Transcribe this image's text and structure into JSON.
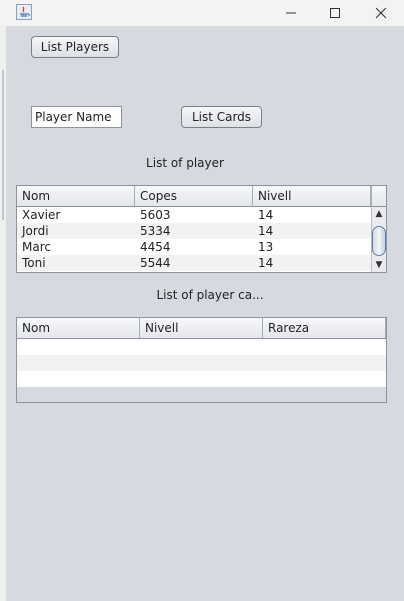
{
  "window": {
    "icon": "java-icon",
    "controls": {
      "minimize": "minimize-icon",
      "maximize": "maximize-icon",
      "close": "close-icon"
    }
  },
  "buttons": {
    "list_players": "List Players",
    "list_cards": "List Cards"
  },
  "player_name_field": {
    "value": "Player Name"
  },
  "players_section": {
    "label": "List of player",
    "columns": [
      "Nom",
      "Copes",
      "Nivell"
    ],
    "rows": [
      [
        "Xavier",
        "5603",
        "14"
      ],
      [
        "Jordi",
        "5334",
        "14"
      ],
      [
        "Marc",
        "4454",
        "13"
      ],
      [
        "Toni",
        "5544",
        "14"
      ]
    ]
  },
  "cards_section": {
    "label": "List of player ca...",
    "columns": [
      "Nom",
      "Nivell",
      "Rareza"
    ]
  }
}
